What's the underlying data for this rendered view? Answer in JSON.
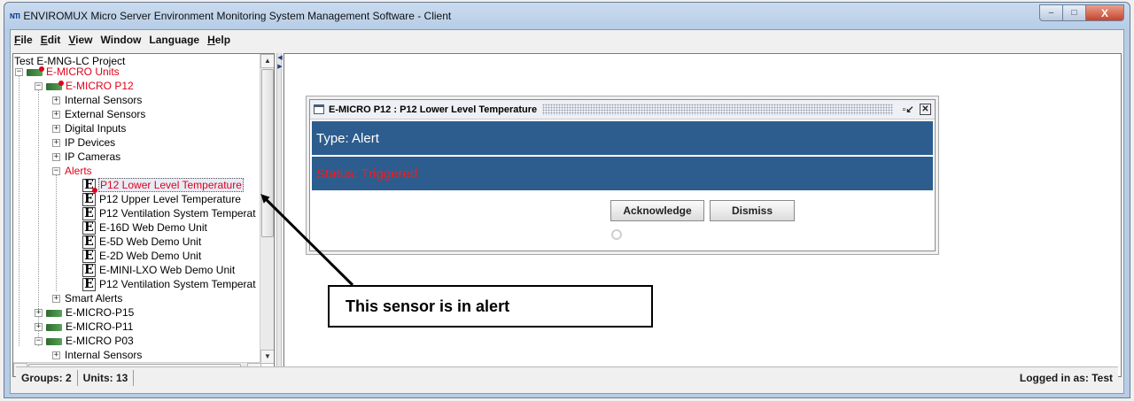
{
  "window": {
    "app_icon": "NTI",
    "title": "ENVIROMUX Micro Server Environment Monitoring System Management Software - Client",
    "min_label": "–",
    "max_label": "□",
    "close_label": "X"
  },
  "menu": [
    {
      "u": "F",
      "rest": "ile"
    },
    {
      "u": "E",
      "rest": "dit"
    },
    {
      "u": "V",
      "rest": "iew"
    },
    {
      "u": "",
      "rest": "Window"
    },
    {
      "u": "",
      "rest": "Language"
    },
    {
      "u": "H",
      "rest": "elp"
    }
  ],
  "tree": {
    "project": "Test E-MNG-LC Project",
    "group": "E-MICRO Units",
    "unit_p12": "E-MICRO P12",
    "internal_sensors": "Internal Sensors",
    "external_sensors": "External Sensors",
    "digital_inputs": "Digital Inputs",
    "ip_devices": "IP Devices",
    "ip_cameras": "IP Cameras",
    "alerts": "Alerts",
    "alert_items": [
      "P12 Lower Level Temperature",
      "P12 Upper Level Temperature",
      "P12 Ventilation System Temperat",
      "E-16D Web Demo Unit",
      "E-5D Web Demo Unit",
      "E-2D Web Demo Unit",
      "E-MINI-LXO Web Demo Unit",
      "P12 Ventilation System Temperat"
    ],
    "e_glyph": "E",
    "smart_alerts": "Smart Alerts",
    "unit_p15": "E-MICRO-P15",
    "unit_p11": "E-MICRO-P11",
    "unit_p03": "E-MICRO P03",
    "p03_internal": "Internal Sensors",
    "plus": "+",
    "minus": "−"
  },
  "alert_window": {
    "title": "E-MICRO P12 : P12 Lower Level Temperature",
    "restore_label": "▫↙",
    "close_label": "✕",
    "type_text": "Type: Alert",
    "status_text": "Status: Triggered",
    "acknowledge_label": "Acknowledge",
    "dismiss_label": "Dismiss"
  },
  "callout": {
    "text": "This sensor is in alert"
  },
  "statusbar": {
    "groups": "Groups: 2",
    "units": "Units: 13",
    "logged_in": "Logged in as: Test"
  },
  "colors": {
    "alert_red": "#e0001b",
    "band_blue": "#2d5d8e"
  },
  "icons": {
    "app": "nti-logo-icon",
    "device": "device-unit-icon",
    "alert_entry": "e-alert-icon",
    "spinner": "spinner-icon"
  }
}
